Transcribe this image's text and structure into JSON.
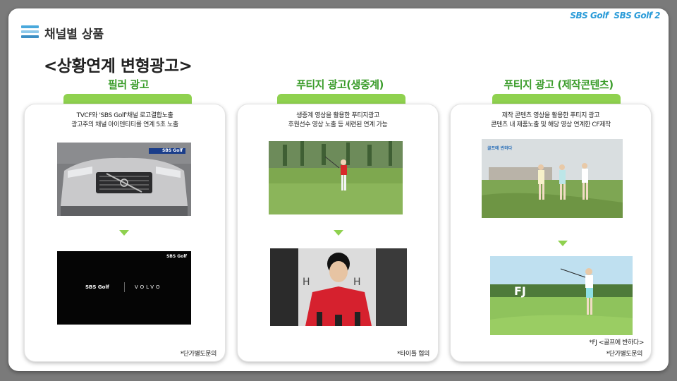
{
  "header": {
    "title": "채널별 상품",
    "logo_1": "SBS Golf",
    "logo_2": "SBS Golf 2"
  },
  "subtitle": "<상황연계 변형광고>",
  "columns": [
    {
      "title": "필러 광고",
      "desc_line_1": "TVCF와 'SBS Golf'채널 로고결합노출",
      "desc_line_2": "광고주의 채널 아이덴티티를 연계 5초 노출",
      "note": "*단가별도문의",
      "top_image_tag": "SBS Golf",
      "bottom_image_logo_left": "SBS Golf",
      "bottom_image_logo_right": "VOLVO",
      "bottom_image_tag": "SBS Golf"
    },
    {
      "title": "푸티지 광고(생중계)",
      "desc_line_1": "생중계 영상을 활용한 푸티지광고",
      "desc_line_2": "후원선수 영상 노출 등 세련된 연계 가능",
      "note": "*타이틀 협의"
    },
    {
      "title": "푸티지 광고 (제작콘텐츠)",
      "desc_line_1": "제작 콘텐츠 영상을 활용한 푸티지 광고",
      "desc_line_2": "콘텐츠 내 제품노출 및 해당 영상 연계한 CF제작",
      "note": "*단가별도문의",
      "caption": "*FJ <골프에 반하다>",
      "top_image_tag": "골프에 반하다",
      "bottom_image_logo": "FJ"
    }
  ],
  "colors": {
    "accent_green": "#8fd14f",
    "title_green": "#3a9c2a",
    "logo_blue": "#2a9bd8"
  }
}
